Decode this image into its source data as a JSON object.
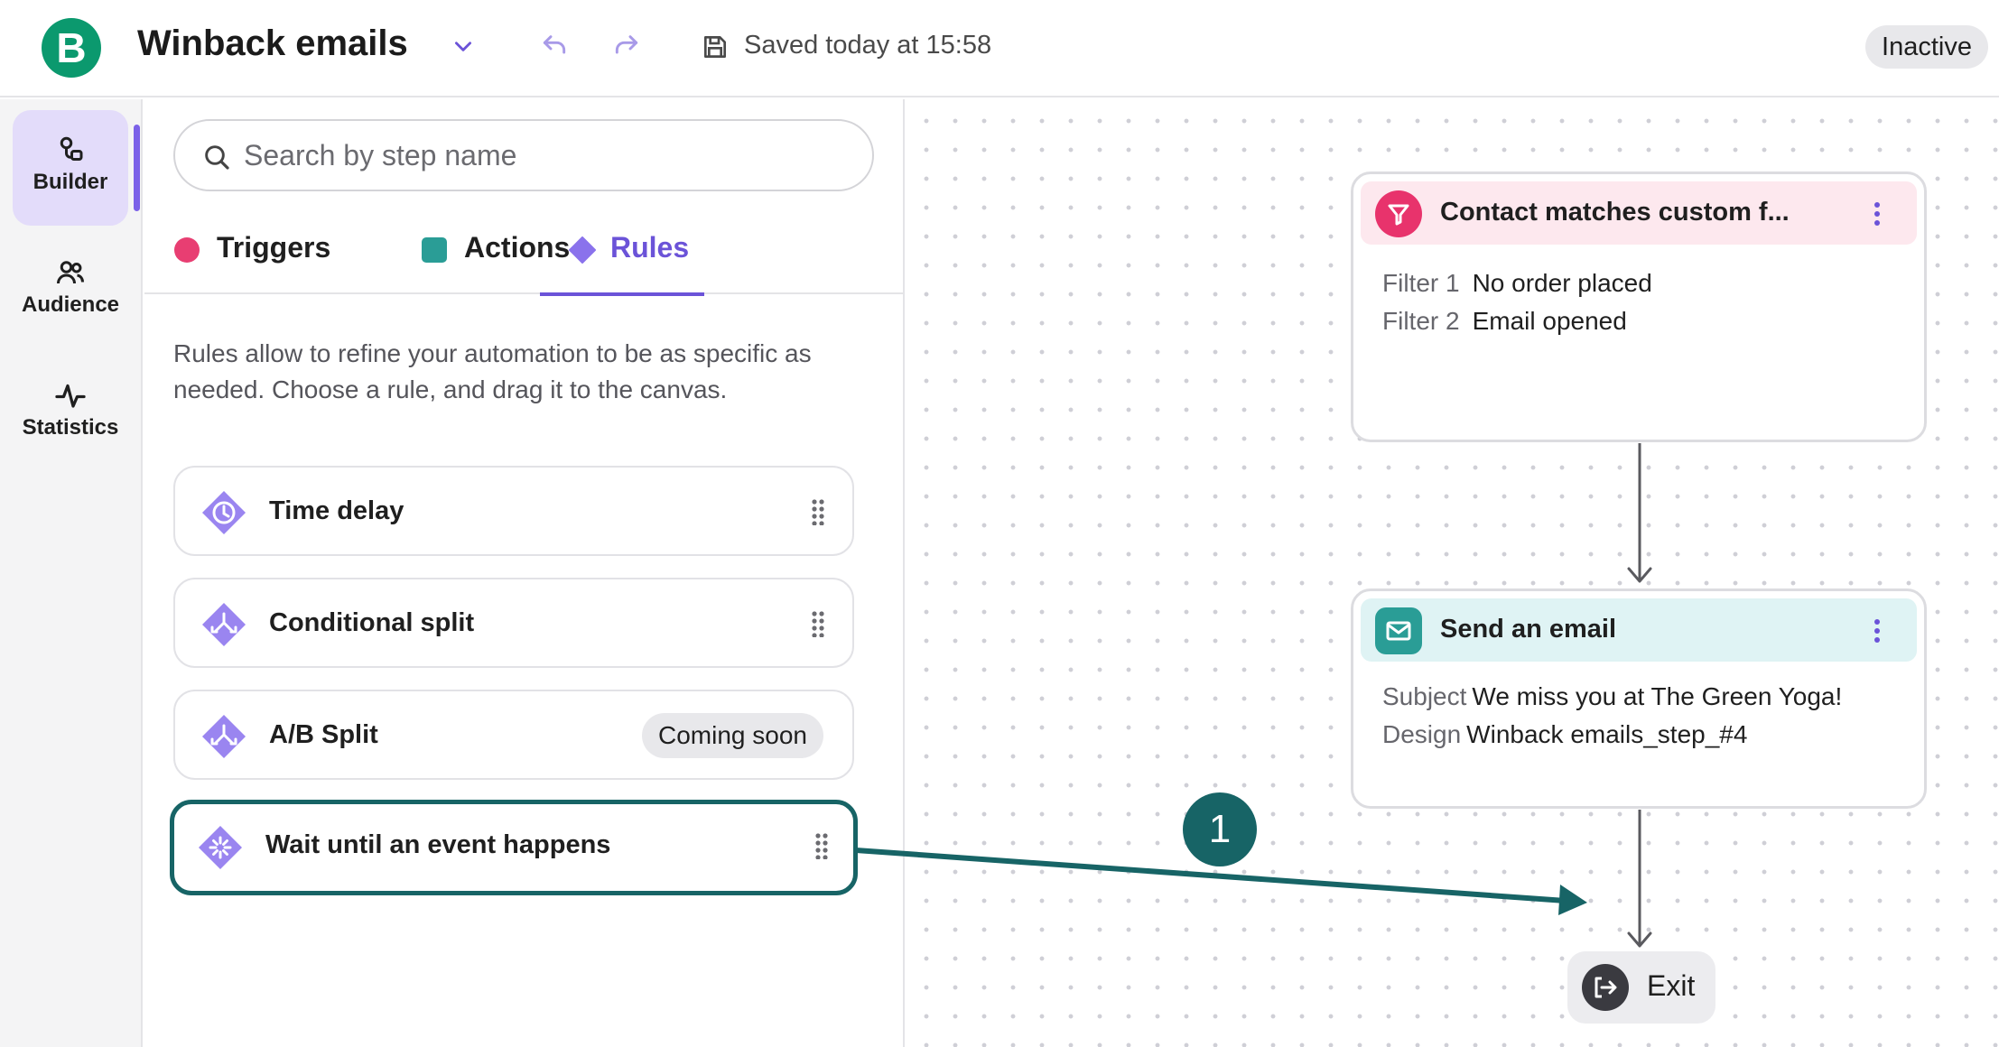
{
  "header": {
    "logo_letter": "B",
    "title": "Winback emails",
    "saved_text": "Saved today at 15:58",
    "status": "Inactive"
  },
  "nav": {
    "items": [
      {
        "label": "Builder",
        "icon": "builder-icon",
        "active": true
      },
      {
        "label": "Audience",
        "icon": "audience-icon"
      },
      {
        "label": "Statistics",
        "icon": "statistics-icon"
      }
    ]
  },
  "panel": {
    "search_placeholder": "Search by step name",
    "tabs": [
      {
        "label": "Triggers",
        "marker_color": "#e83e72"
      },
      {
        "label": "Actions",
        "marker_color": "#2a9d96"
      },
      {
        "label": "Rules",
        "marker_color": "#8a72ec",
        "active": true
      }
    ],
    "description": "Rules allow to refine your automation to be as specific as needed. Choose a rule, and drag it to the canvas.",
    "rules": [
      {
        "label": "Time delay",
        "icon": "clock-icon"
      },
      {
        "label": "Conditional split",
        "icon": "split-icon"
      },
      {
        "label": "A/B Split",
        "icon": "ab-split-icon",
        "badge": "Coming soon"
      },
      {
        "label": "Wait until an event happens",
        "icon": "event-icon",
        "highlighted": true
      }
    ]
  },
  "canvas": {
    "nodes": [
      {
        "title": "Contact matches custom f...",
        "icon": "filter-icon",
        "head_color": "#fde8ee",
        "icon_color": "#e8336c",
        "rows": [
          {
            "key": "Filter 1",
            "value": "No order placed"
          },
          {
            "key": "Filter 2",
            "value": "Email opened"
          }
        ]
      },
      {
        "title": "Send an email",
        "icon": "mail-icon",
        "head_color": "#dff3f4",
        "icon_color": "#2a9d96",
        "rows": [
          {
            "key": "Subject",
            "value": "We miss you at The Green Yoga!"
          },
          {
            "key": "Design",
            "value": "Winback emails_step_#4"
          }
        ]
      }
    ],
    "exit_label": "Exit",
    "step_number": "1"
  },
  "colors": {
    "brand": "#0b996e",
    "accent": "#6b53d8",
    "highlight": "#176466"
  }
}
